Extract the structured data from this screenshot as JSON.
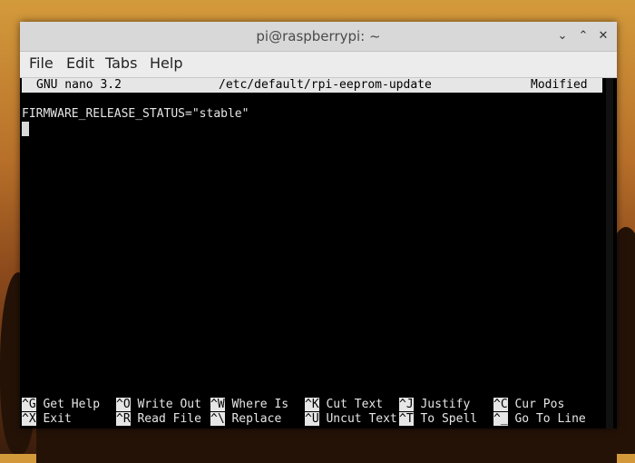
{
  "window": {
    "title": "pi@raspberrypi: ~",
    "controls": {
      "minimize_glyph": "⌄",
      "maximize_glyph": "⌃",
      "close_glyph": "✕"
    }
  },
  "menubar": {
    "items": [
      "File",
      "Edit",
      "Tabs",
      "Help"
    ]
  },
  "nano": {
    "version": "GNU nano 3.2",
    "filename": "/etc/default/rpi-eeprom-update",
    "status": "Modified",
    "content_lines": [
      "FIRMWARE_RELEASE_STATUS=\"stable\""
    ],
    "shortcuts_row1": [
      {
        "key": "^G",
        "label": "Get Help"
      },
      {
        "key": "^O",
        "label": "Write Out"
      },
      {
        "key": "^W",
        "label": "Where Is"
      },
      {
        "key": "^K",
        "label": "Cut Text"
      },
      {
        "key": "^J",
        "label": "Justify"
      },
      {
        "key": "^C",
        "label": "Cur Pos"
      }
    ],
    "shortcuts_row2": [
      {
        "key": "^X",
        "label": "Exit"
      },
      {
        "key": "^R",
        "label": "Read File"
      },
      {
        "key": "^\\",
        "label": "Replace"
      },
      {
        "key": "^U",
        "label": "Uncut Text"
      },
      {
        "key": "^T",
        "label": "To Spell"
      },
      {
        "key": "^_",
        "label": "Go To Line"
      }
    ]
  },
  "colors": {
    "terminal_bg": "#000000",
    "terminal_fg": "#e6e6e6",
    "titlebar_bg": "#d8d8d8",
    "menubar_bg": "#ececec"
  }
}
